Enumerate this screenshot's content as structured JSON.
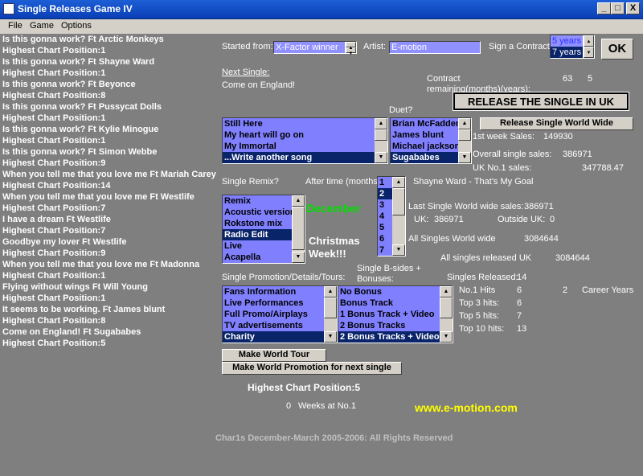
{
  "window": {
    "title": "Single Releases Game IV",
    "min": "_",
    "max": "□",
    "close": "X"
  },
  "menu": [
    "File",
    "Game",
    "Options"
  ],
  "log": [
    "Is this gonna work?  Ft Arctic Monkeys",
    "Highest Chart Position:1",
    "Is this gonna work?  Ft Shayne Ward",
    "Highest Chart Position:1",
    "Is this gonna work?  Ft Beyonce",
    "Highest Chart Position:8",
    "Is this gonna work?  Ft Pussycat Dolls",
    "Highest Chart Position:1",
    "Is this gonna work?  Ft Kylie Minogue",
    "Highest Chart Position:1",
    "Is this gonna work?  Ft Simon Webbe",
    "Highest Chart Position:9",
    "When you tell me that you love me  Ft Mariah Carey",
    "Highest Chart Position:14",
    "When you tell me that you love me  Ft Westlife",
    "Highest Chart Position:7",
    "I have a dream  Ft Westlife",
    "Highest Chart Position:7",
    "Goodbye my lover  Ft Westlife",
    "Highest Chart Position:9",
    "When you tell me that you love me  Ft Madonna",
    "Highest Chart Position:1",
    "Flying without wings  Ft Will Young",
    "Highest Chart Position:1",
    "It seems to be working.  Ft James blunt",
    "Highest Chart Position:8",
    "Come on England!  Ft Sugababes",
    "Highest Chart Position:5"
  ],
  "started_from": {
    "label": "Started from:",
    "value": "X-Factor winner"
  },
  "artist": {
    "label": "Artist:",
    "value": "E-motion"
  },
  "contract": {
    "label": "Sign a Contract:",
    "option_top": "5 years",
    "value": "7 years",
    "ok": "OK"
  },
  "next_single": {
    "label": "Next Single:",
    "value": "Come on England!"
  },
  "contract_remaining": {
    "label1": "Contract",
    "label2": "remaining(months)(years):",
    "months": "63",
    "years": "5"
  },
  "release_uk": "RELEASE THE SINGLE IN UK",
  "release_world": "Release Single World Wide",
  "songs": [
    "Still Here",
    "My heart will go on",
    "My Immortal",
    "...Write another song"
  ],
  "duet": {
    "label": "Duet?",
    "items": [
      "Brian McFadden",
      "James blunt",
      "Michael jackson",
      "Sugababes"
    ]
  },
  "stats": {
    "first_week_label": "1st week Sales:",
    "first_week": "149930",
    "overall_label": "Overall single sales:",
    "overall": "386971",
    "uk_no1_label": "UK No.1 sales:",
    "uk_no1": "347788.47",
    "last_world_label": "Last Single World wide sales:",
    "last_world": "386971",
    "uk_label": "UK:",
    "uk": "386971",
    "outside_label": "Outside UK:",
    "outside": "0",
    "all_world_label": "All Singles World wide",
    "all_world": "3084644",
    "all_uk_label": "All singles released UK",
    "all_uk": "3084644"
  },
  "remix": {
    "label": "Single Remix?",
    "items": [
      "Remix",
      "Acoustic version",
      "Rokstone mix",
      "Radio Edit",
      "Live",
      "Acapella"
    ]
  },
  "after_time": {
    "label": "After time (months):",
    "items": [
      "1",
      "2",
      "3",
      "4",
      "5",
      "6",
      "7"
    ]
  },
  "current_song": "Shayne Ward - That's My Goal",
  "month": "December",
  "christmas": [
    "Christmas",
    "Week!!!"
  ],
  "promotion": {
    "label": "Single Promotion/Details/Tours:",
    "items": [
      "Fans Information",
      "Live Performances",
      "Full Promo/Airplays",
      "TV advertisements",
      "Charity"
    ]
  },
  "bsides": {
    "label1": "Single B-sides +",
    "label2": "Bonuses:",
    "items": [
      "No Bonus",
      "Bonus Track",
      "1 Bonus Track + Video",
      "2 Bonus Tracks",
      "2 Bonus Tracks + Video"
    ]
  },
  "hits": {
    "released_label": "Singles Released:",
    "released": "14",
    "no1_label": "No.1 Hits",
    "no1": "6",
    "career": "2",
    "career_label": "Career Years",
    "top3_label": "Top 3 hits:",
    "top3": "6",
    "top5_label": "Top 5 hits:",
    "top5": "7",
    "top10_label": "Top 10 hits:",
    "top10": "13"
  },
  "world_tour": "Make World Tour",
  "world_promo": "Make World Promotion for next single",
  "highest": "Highest Chart Position:5",
  "weeks": {
    "value": "0",
    "label": "Weeks at No.1"
  },
  "website": "www.e-motion.com",
  "footer": "Char1s December-March 2005-2006: All Rights Reserved",
  "colors": {
    "list_bg": "#8080ff",
    "selected": "#0a246a",
    "accent_green": "#00ff00",
    "accent_yellow": "#ffff00"
  }
}
